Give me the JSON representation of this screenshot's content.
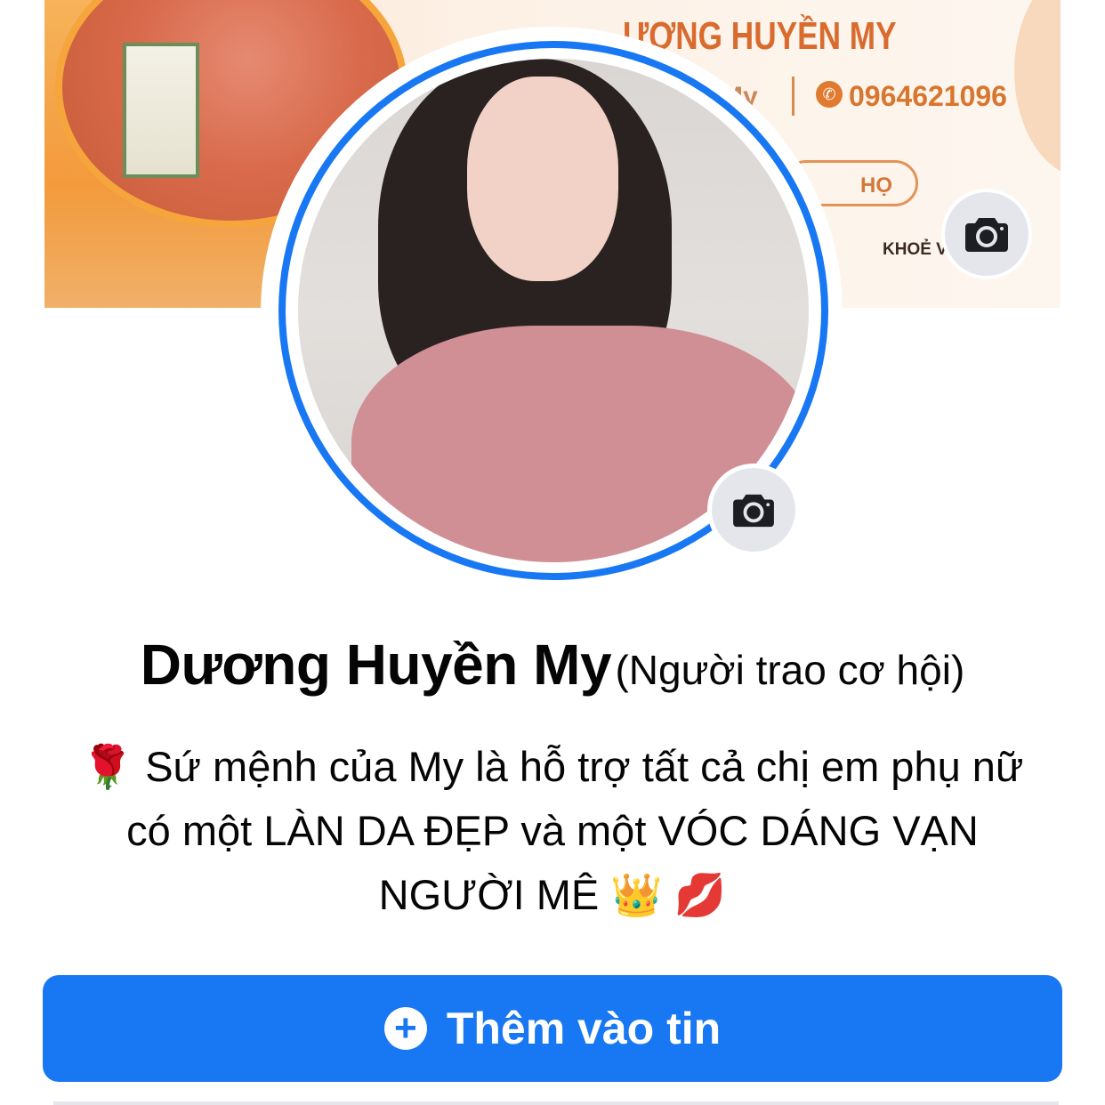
{
  "cover": {
    "title": "ƯƠNG HUYỀN MY",
    "subtitle_name": "My",
    "phone": "0964621096",
    "pill_label": "HỌ",
    "tagline": "KHOẺ VÀ LÀM"
  },
  "profile": {
    "name": "Dương Huyền My",
    "alternate_name": "(Người trao cơ hội)",
    "bio_line1": "🌹 Sứ mệnh của My là hỗ trợ tất cả chị em phụ nữ",
    "bio_line2": "có một LÀN DA ĐẸP và một VÓC DÁNG VẠN",
    "bio_line3": "NGƯỜI MÊ 👑 💋"
  },
  "actions": {
    "add_story_label": "Thêm vào tin",
    "add_story_icon": "plus-circle-icon"
  },
  "icons": {
    "cover_camera": "camera-icon",
    "profile_camera": "camera-icon"
  },
  "colors": {
    "accent": "#1877f2",
    "cover_orange": "#f39a3c",
    "text": "#050505"
  }
}
